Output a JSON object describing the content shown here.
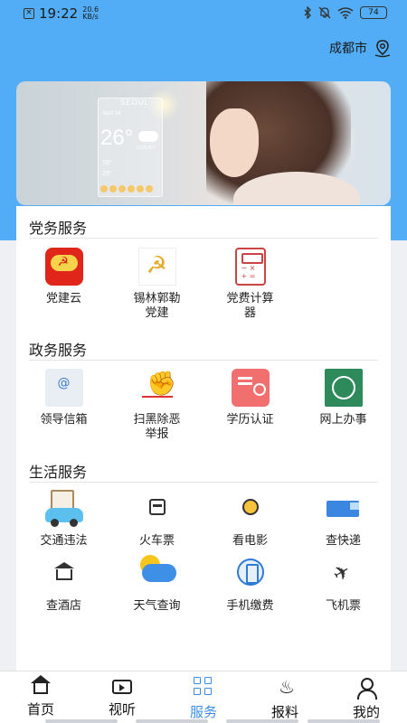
{
  "status_bar": {
    "time": "19:22",
    "speed_value": "20.6",
    "speed_unit": "KB/s",
    "battery": "74"
  },
  "header": {
    "city": "成都市"
  },
  "banner": {
    "weather_city": "SEOUL",
    "weather_date": "April 14",
    "weather_temp": "26°",
    "weather_condition": "CLOUDY",
    "weather_low": "18°",
    "weather_high": "29°"
  },
  "sections": [
    {
      "title": "党务服务",
      "items": [
        {
          "label": "党建云",
          "icon": "party-cloud-icon"
        },
        {
          "label": "锡林郭勒\n党建",
          "icon": "hammer-sickle-icon"
        },
        {
          "label": "党费计算\n器",
          "icon": "calculator-icon"
        }
      ]
    },
    {
      "title": "政务服务",
      "items": [
        {
          "label": "领导信箱",
          "icon": "mailbox-icon"
        },
        {
          "label": "扫黑除恶\n举报",
          "icon": "fist-icon"
        },
        {
          "label": "学历认证",
          "icon": "certificate-icon"
        },
        {
          "label": "网上办事",
          "icon": "seal-icon"
        }
      ]
    },
    {
      "title": "生活服务",
      "items": [
        {
          "label": "交通违法",
          "icon": "car-icon"
        },
        {
          "label": "火车票",
          "icon": "train-icon"
        },
        {
          "label": "看电影",
          "icon": "film-icon"
        },
        {
          "label": "查快递",
          "icon": "truck-icon"
        },
        {
          "label": "查酒店",
          "icon": "hotel-icon"
        },
        {
          "label": "天气查询",
          "icon": "weather-icon"
        },
        {
          "label": "手机缴费",
          "icon": "phone-icon"
        },
        {
          "label": "飞机票",
          "icon": "plane-icon"
        }
      ]
    }
  ],
  "bottom_nav": [
    {
      "label": "首页",
      "icon": "home-icon",
      "active": false
    },
    {
      "label": "视听",
      "icon": "video-icon",
      "active": false
    },
    {
      "label": "服务",
      "icon": "grid-icon",
      "active": true
    },
    {
      "label": "报料",
      "icon": "fire-icon",
      "active": false
    },
    {
      "label": "我的",
      "icon": "user-icon",
      "active": false
    }
  ],
  "colors": {
    "header_blue": "#52adf6",
    "accent": "#3b8ee6"
  }
}
